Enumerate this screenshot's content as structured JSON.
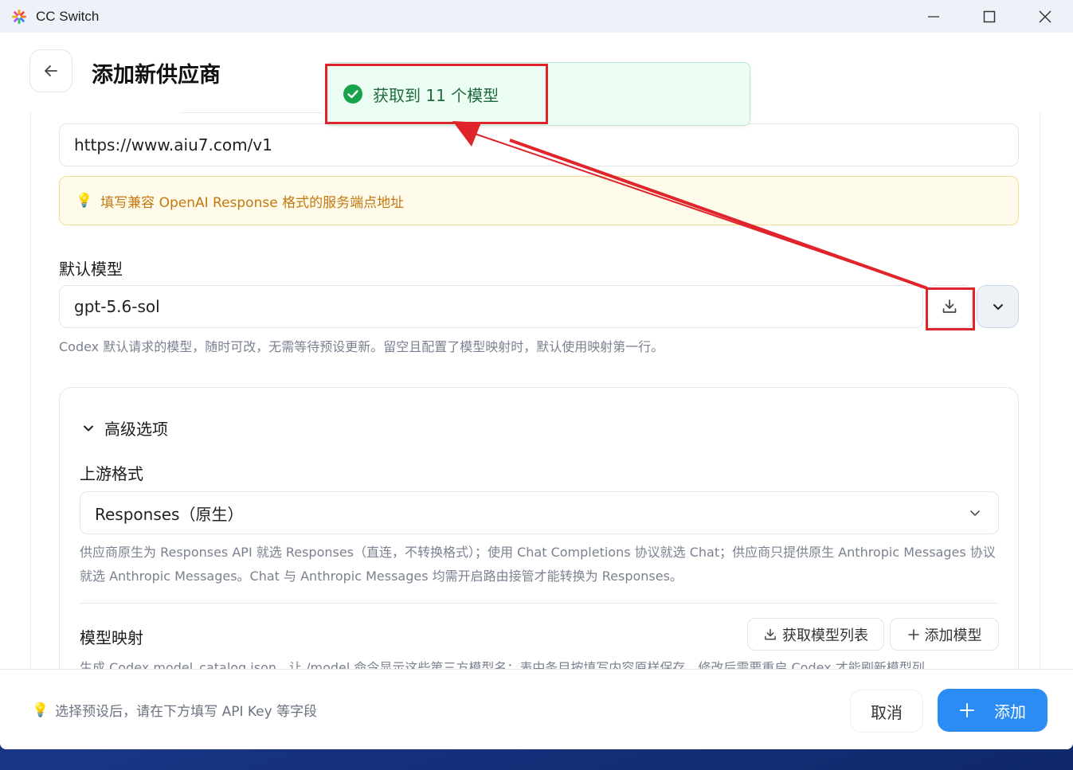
{
  "window": {
    "title": "CC Switch"
  },
  "page": {
    "title": "添加新供应商"
  },
  "form": {
    "base_url_value": "https://www.aiu7.com/v1",
    "base_url_hint": "填写兼容 OpenAI Response 格式的服务端点地址",
    "default_model_label": "默认模型",
    "default_model_value": "gpt-5.6-sol",
    "default_model_help": "Codex 默认请求的模型，随时可改，无需等待预设更新。留空且配置了模型映射时，默认使用映射第一行。"
  },
  "advanced": {
    "toggle_label": "高级选项",
    "upstream_label": "上游格式",
    "upstream_value": "Responses（原生）",
    "upstream_help": "供应商原生为 Responses API 就选 Responses（直连，不转换格式）；使用 Chat Completions 协议就选 Chat；供应商只提供原生 Anthropic Messages 协议就选 Anthropic Messages。Chat 与 Anthropic Messages 均需开启路由接管才能转换为 Responses。",
    "mapping_label": "模型映射",
    "fetch_list_label": "获取模型列表",
    "add_model_label": "添加模型",
    "mapping_help": "生成 Codex model_catalog.json，让 /model 命令显示这些第三方模型名；表中条目按填写内容原样保存，修改后需要重启 Codex 才能刷新模型列"
  },
  "footer": {
    "hint": "选择预设后，请在下方填写 API Key 等字段",
    "cancel_label": "取消",
    "add_label": "添加"
  },
  "toast": {
    "message": "获取到 11 个模型"
  },
  "colors": {
    "accent": "#2b8cf3",
    "success": "#16a34a",
    "hint_text": "#c2780e",
    "annotation": "#e0242b"
  }
}
